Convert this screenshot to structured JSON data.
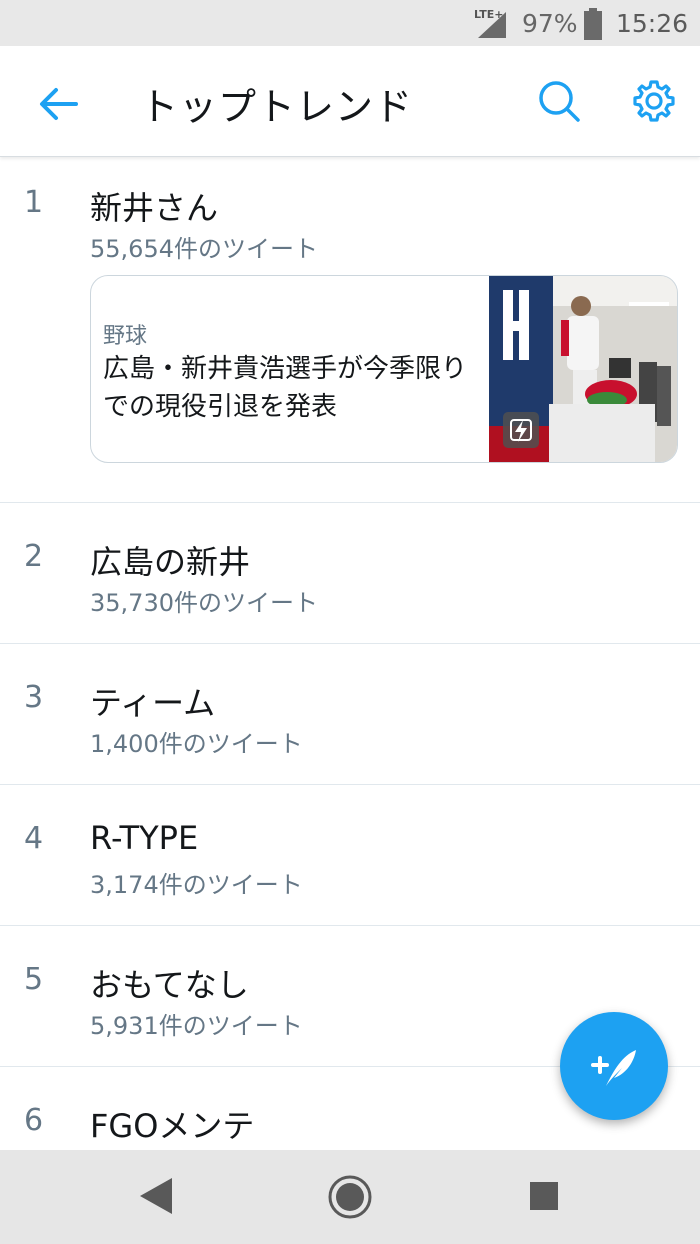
{
  "status_bar": {
    "network": "LTE+",
    "battery_percent": "97%",
    "time": "15:26"
  },
  "app_bar": {
    "title": "トップトレンド",
    "icons": [
      "back-arrow-icon",
      "search-icon",
      "gear-icon"
    ],
    "accent_color": "#1da1f2"
  },
  "trends": [
    {
      "rank": "1",
      "name": "新井さん",
      "count": "55,654件のツイート",
      "card": {
        "category": "野球",
        "headline": "広島・新井貴浩選手が今季限りでの現役引退を発表",
        "badge_icon": "lightning-icon"
      }
    },
    {
      "rank": "2",
      "name": "広島の新井",
      "count": "35,730件のツイート"
    },
    {
      "rank": "3",
      "name": "ティーム",
      "count": "1,400件のツイート"
    },
    {
      "rank": "4",
      "name": "R-TYPE",
      "count": "3,174件のツイート"
    },
    {
      "rank": "5",
      "name": "おもてなし",
      "count": "5,931件のツイート"
    },
    {
      "rank": "6",
      "name": "FGOメンテ",
      "count": ""
    }
  ],
  "fab": {
    "icon": "compose-tweet-icon"
  },
  "nav_bar": {
    "icons": [
      "nav-back-icon",
      "nav-home-icon",
      "nav-recents-icon"
    ]
  }
}
